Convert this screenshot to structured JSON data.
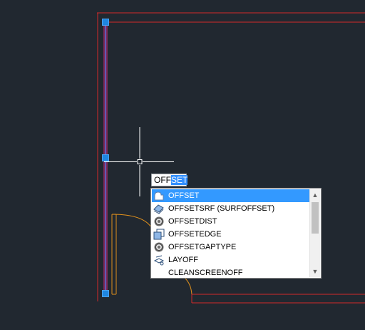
{
  "command_line": {
    "typed": "OFF",
    "autocomplete": "SET"
  },
  "autocomplete_list": {
    "items": [
      {
        "label": "OFFSET",
        "icon": "offset-icon",
        "selected": true
      },
      {
        "label": "OFFSETSRF (SURFOFFSET)",
        "icon": "surface-offset-icon",
        "selected": false
      },
      {
        "label": "OFFSETDIST",
        "icon": "gear-icon",
        "selected": false
      },
      {
        "label": "OFFSETEDGE",
        "icon": "offset-edge-icon",
        "selected": false
      },
      {
        "label": "OFFSETGAPTYPE",
        "icon": "gear-icon",
        "selected": false
      },
      {
        "label": "LAYOFF",
        "icon": "layer-off-icon",
        "selected": false
      },
      {
        "label": "CLEANSCREENOFF",
        "icon": "",
        "selected": false
      }
    ],
    "scroll_up_glyph": "▲",
    "scroll_down_glyph": "▼"
  },
  "colors": {
    "background": "#212830",
    "red_lines": "#d42a2a",
    "orange_lines": "#e0901c",
    "selected_line": "#7b2a58",
    "grip": "#1f86e0",
    "crosshair": "#ffffff",
    "selection_highlight": "#3399ff"
  }
}
